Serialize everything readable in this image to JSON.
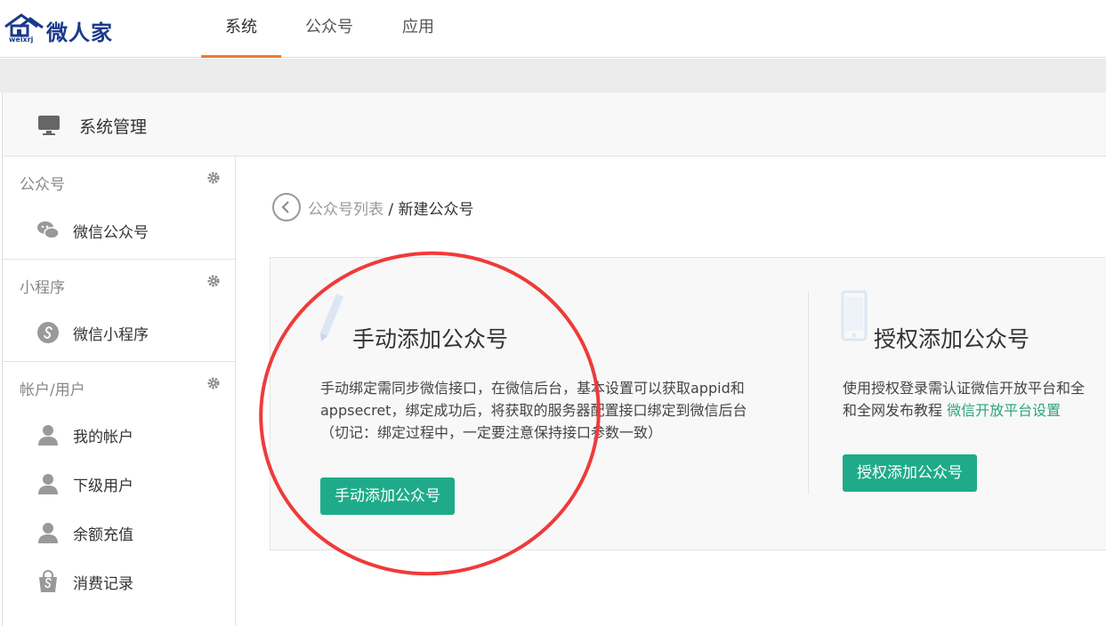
{
  "brand": {
    "name": "微人家",
    "sub": "weixrj"
  },
  "nav": {
    "tabs": [
      {
        "label": "系统"
      },
      {
        "label": "公众号"
      },
      {
        "label": "应用"
      }
    ]
  },
  "header": {
    "title": "系统管理"
  },
  "sidebar": {
    "groups": [
      {
        "title": "公众号",
        "items": [
          {
            "label": "微信公众号",
            "icon": "wechat-icon"
          }
        ]
      },
      {
        "title": "小程序",
        "items": [
          {
            "label": "微信小程序",
            "icon": "mini-program-icon"
          }
        ]
      },
      {
        "title": "帐户/用户",
        "items": [
          {
            "label": "我的帐户",
            "icon": "user-icon"
          },
          {
            "label": "下级用户",
            "icon": "user-icon"
          },
          {
            "label": "余额充值",
            "icon": "user-icon"
          },
          {
            "label": "消费记录",
            "icon": "shopping-bag-icon"
          }
        ]
      }
    ]
  },
  "breadcrumb": {
    "parent": "公众号列表",
    "sep": "/",
    "current": "新建公众号"
  },
  "manual": {
    "title": "手动添加公众号",
    "desc1": "手动绑定需同步微信接口，在微信后台，基本设置可以获取appid和",
    "desc2": "appsecret，绑定成功后，将获取的服务器配置接口绑定到微信后台",
    "desc3": "（切记：绑定过程中，一定要注意保持接口参数一致）",
    "button": "手动添加公众号"
  },
  "auth": {
    "title": "授权添加公众号",
    "desc1": "使用授权登录需认证微信开放平台和全",
    "desc2": "和全网发布教程",
    "link": "微信开放平台设置",
    "button": "授权添加公众号"
  },
  "colors": {
    "accent": "#1fab89",
    "nav_active": "#f07a2c",
    "annotation": "#f03a3a"
  }
}
